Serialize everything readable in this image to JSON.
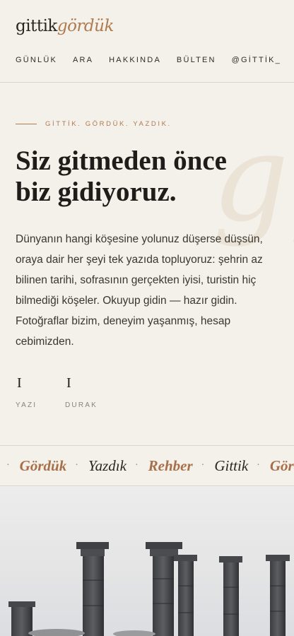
{
  "logo": {
    "part1": "gittik",
    "part2": "gördük"
  },
  "nav": [
    {
      "label": "GÜNLÜK"
    },
    {
      "label": "ARA"
    },
    {
      "label": "HAKKINDA"
    },
    {
      "label": "BÜLTEN"
    },
    {
      "label": "@GİTTİK_"
    }
  ],
  "hero": {
    "eyebrow": "GİTTİK. GÖRDÜK. YAZDIK.",
    "title_line1": "Siz gitmeden önce",
    "title_line2": "biz gidiyoruz.",
    "background_mark": "gg",
    "lead": "Dünyanın hangi köşesine yolunuz düşerse düşsün, oraya dair her şeyi tek yazıda topluyoruz: şehrin az bilinen tarihi, sofrasının gerçekten iyisi, turistin hiç bilmediği köşeler. Okuyup gidin — hazır gidin. Fotoğraflar bizim, deneyim yaşanmış, hesap cebimizden.",
    "stats": [
      {
        "value": "I",
        "label": "YAZI"
      },
      {
        "value": "I",
        "label": "DURAK"
      }
    ]
  },
  "ticker": {
    "items": [
      {
        "word": "Gördük",
        "accent": true
      },
      {
        "word": "Yazdık",
        "accent": false
      },
      {
        "word": "Rehber",
        "accent": true
      },
      {
        "word": "Gittik",
        "accent": false
      },
      {
        "word": "Gördük",
        "accent": true
      }
    ],
    "separator": "·"
  },
  "colors": {
    "background": "#f3f1ea",
    "accent": "#b07a4f",
    "text": "#2a2723",
    "muted": "#8a847a"
  }
}
